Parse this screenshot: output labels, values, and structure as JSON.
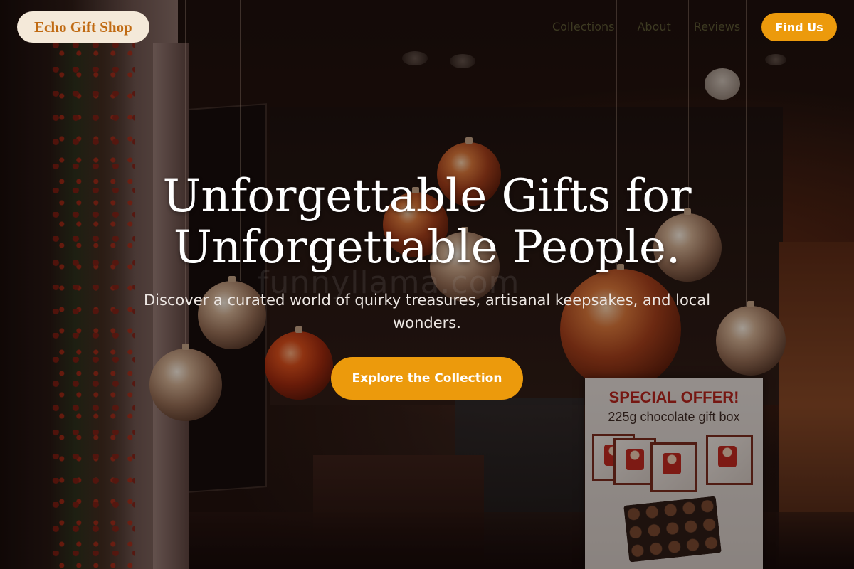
{
  "brand": {
    "name": "Echo Gift Shop",
    "accent": "#ec9a0c",
    "logo_bg": "#f4e9d9",
    "logo_text_color": "#c06a12"
  },
  "nav": {
    "items": [
      {
        "label": "Collections"
      },
      {
        "label": "About"
      },
      {
        "label": "Reviews"
      }
    ],
    "cta_label": "Find Us"
  },
  "hero": {
    "title_line1": "Unforgettable Gifts for",
    "title_line2": "Unforgettable People.",
    "subtitle": "Discover a curated world of quirky treasures, artisanal keepsakes, and local wonders.",
    "cta_label": "Explore the Collection"
  },
  "background_photo": {
    "watermark": "funnyllama.com",
    "sign_title": "SPECIAL OFFER!",
    "sign_subtitle": "225g chocolate gift box"
  }
}
